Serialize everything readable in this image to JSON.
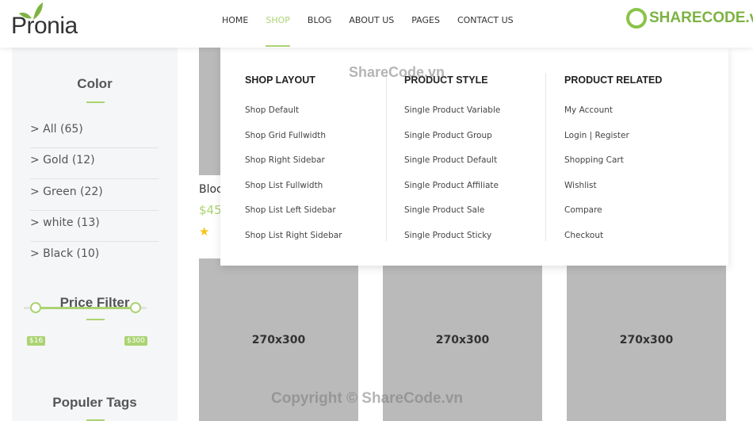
{
  "header": {
    "logo": "Pronia",
    "nav": [
      "HOME",
      "SHOP",
      "BLOG",
      "ABOUT US",
      "PAGES",
      "CONTACT US"
    ],
    "active": "SHOP",
    "sharecode_logo": "SHARECODE.vn"
  },
  "sidebar": {
    "color_title": "Color",
    "colors": [
      "> All (65)",
      "> Gold (12)",
      "> Green (22)",
      "> white (13)",
      "> Black (10)"
    ],
    "price_title": "Price Filter",
    "price_min": "$16",
    "price_max": "$300",
    "tags_title": "Populer Tags"
  },
  "product": {
    "title": "Bloc",
    "price": "$45",
    "star": "★"
  },
  "placeholders": [
    "270x300",
    "270x300",
    "270x300"
  ],
  "mega": {
    "columns": [
      {
        "title": "SHOP LAYOUT",
        "items": [
          "Shop Default",
          "Shop Grid Fullwidth",
          "Shop Right Sidebar",
          "Shop List Fullwidth",
          "Shop List Left Sidebar",
          "Shop List Right Sidebar"
        ]
      },
      {
        "title": "PRODUCT STYLE",
        "items": [
          "Single Product Variable",
          "Single Product Group",
          "Single Product Default",
          "Single Product Affiliate",
          "Single Product Sale",
          "Single Product Sticky"
        ]
      },
      {
        "title": "PRODUCT RELATED",
        "items": [
          "My Account",
          "Login | Register",
          "Shopping Cart",
          "Wishlist",
          "Compare",
          "Checkout"
        ]
      }
    ]
  },
  "watermarks": {
    "top": "ShareCode.vn",
    "bottom": "Copyright © ShareCode.vn"
  },
  "colors": {
    "accent": "#abd373"
  }
}
